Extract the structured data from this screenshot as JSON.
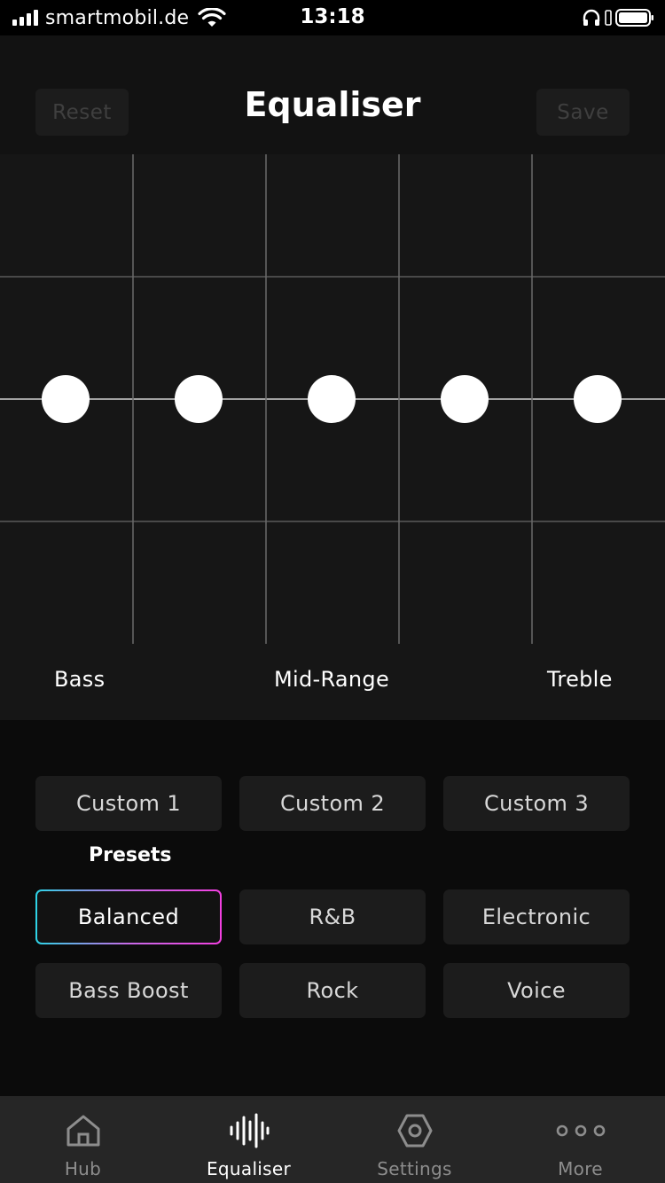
{
  "status_bar": {
    "carrier": "smartmobil.de",
    "time": "13:18"
  },
  "header": {
    "reset_label": "Reset",
    "title": "Equaliser",
    "save_label": "Save"
  },
  "equaliser": {
    "band_labels": [
      "Bass",
      "Mid-Range",
      "Treble"
    ],
    "band_levels": [
      0,
      0,
      0,
      0,
      0
    ],
    "line_gradient": [
      "#5ab4ec",
      "#5b86f0",
      "#8a6cf0",
      "#b85ef0"
    ]
  },
  "presets": {
    "custom": [
      "Custom 1",
      "Custom 2",
      "Custom 3"
    ],
    "heading": "Presets",
    "items": [
      "Balanced",
      "R&B",
      "Electronic",
      "Bass Boost",
      "Rock",
      "Voice"
    ],
    "selected": "Balanced"
  },
  "tabs": [
    {
      "label": "Hub",
      "icon": "home-icon"
    },
    {
      "label": "Equaliser",
      "icon": "waveform-icon",
      "active": true
    },
    {
      "label": "Settings",
      "icon": "hexagon-gear-icon"
    },
    {
      "label": "More",
      "icon": "more-dots-icon"
    }
  ]
}
